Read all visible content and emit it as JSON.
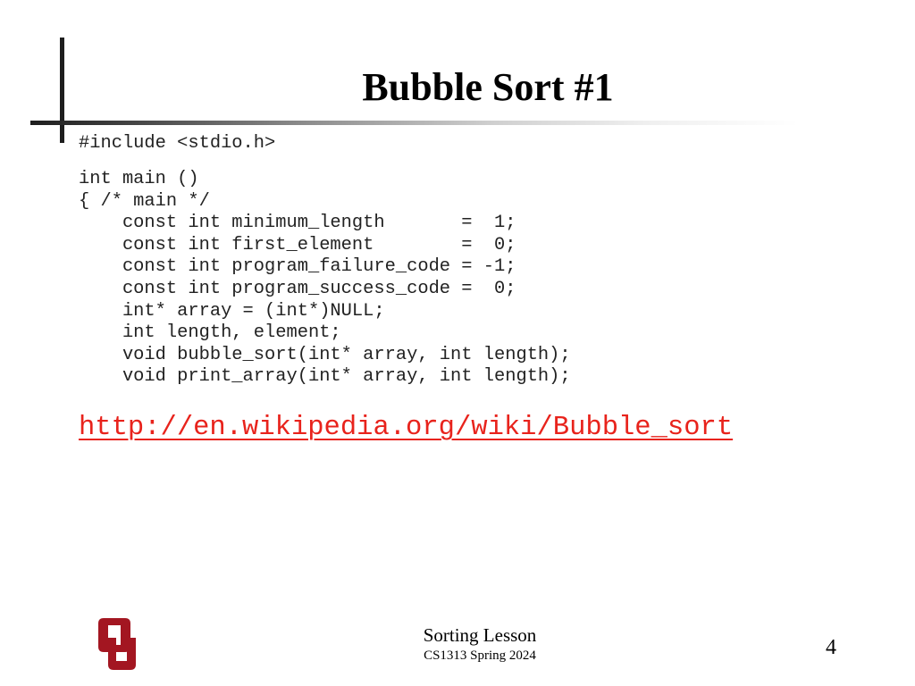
{
  "slide": {
    "title": "Bubble Sort #1",
    "code_include": "#include <stdio.h>",
    "code_lines": [
      "int main ()",
      "{ /* main */",
      "    const int minimum_length       =  1;",
      "    const int first_element        =  0;",
      "    const int program_failure_code = -1;",
      "    const int program_success_code =  0;",
      "    int* array = (int*)NULL;",
      "    int length, element;",
      "    void bubble_sort(int* array, int length);",
      "    void print_array(int* array, int length);"
    ],
    "link_text": "http://en.wikipedia.org/wiki/Bubble_sort",
    "link_color": "#e8231c"
  },
  "footer": {
    "logo": "ou-logo-icon",
    "logo_color": "#a31621",
    "title": "Sorting Lesson",
    "subtitle": "CS1313 Spring 2024",
    "page_number": "4"
  }
}
